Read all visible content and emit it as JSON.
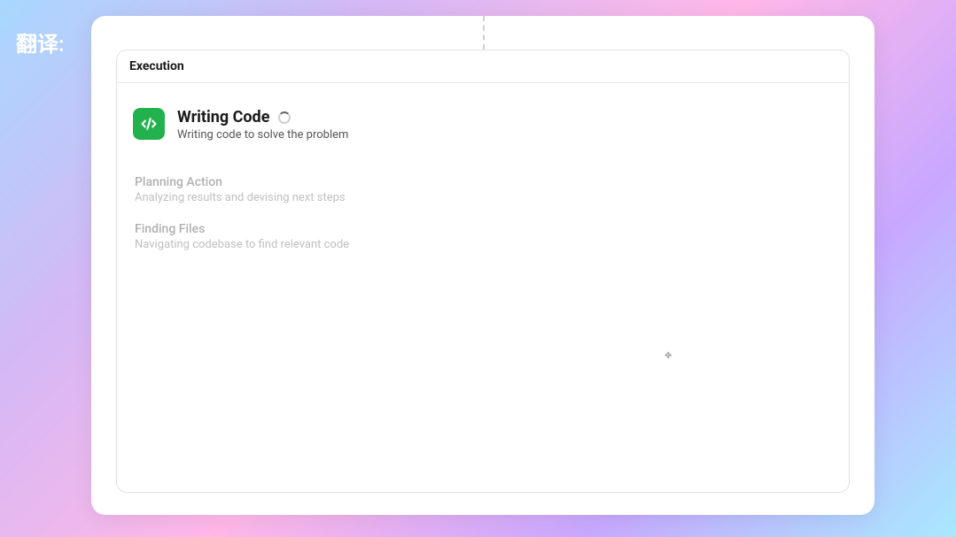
{
  "overlay": {
    "label": "翻译:"
  },
  "card": {
    "header_title": "Execution"
  },
  "steps": {
    "active": {
      "title": "Writing Code",
      "description": "Writing code to solve the problem",
      "icon_name": "code-icon"
    },
    "inactive": [
      {
        "title": "Planning Action",
        "description": "Analyzing results and devising next steps"
      },
      {
        "title": "Finding Files",
        "description": "Navigating codebase to find relevant code"
      }
    ]
  },
  "colors": {
    "accent_green": "#22b14c",
    "card_border": "#e2e2e2",
    "text_primary": "#1a1a1a",
    "text_muted": "#b0b0b0"
  }
}
